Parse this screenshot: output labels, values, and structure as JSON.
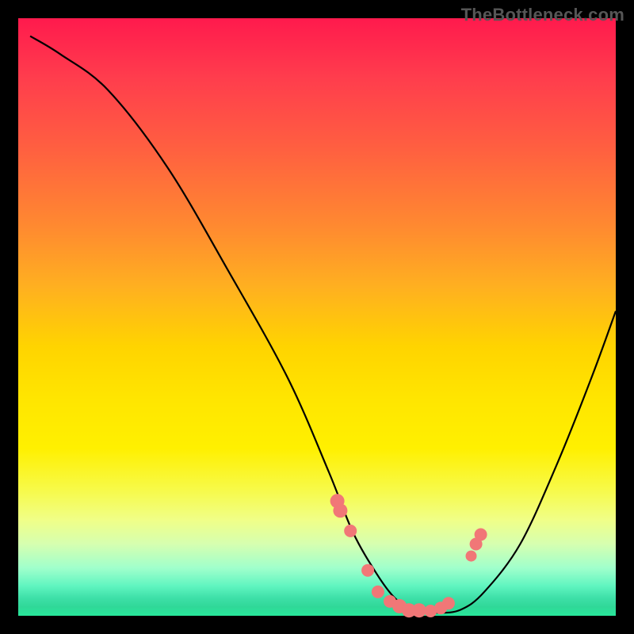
{
  "watermark": "TheBottleneck.com",
  "colors": {
    "background": "#000000",
    "gradient_top": "#ff1a4d",
    "gradient_bottom": "#28e69a",
    "curve": "#000000",
    "bead": "#f17777"
  },
  "chart_data": {
    "type": "line",
    "title": "",
    "xlabel": "",
    "ylabel": "",
    "xrange": [
      0,
      100
    ],
    "yrange": [
      0,
      100
    ],
    "series": [
      {
        "name": "bottleneck-curve",
        "x": [
          2,
          7,
          15,
          25,
          35,
          45,
          52,
          56,
          60,
          63,
          66,
          70,
          74,
          78,
          84,
          90,
          96,
          100
        ],
        "y": [
          97,
          94,
          88,
          75,
          58,
          40,
          24,
          14,
          7,
          3,
          1,
          0.5,
          1,
          4,
          12,
          25,
          40,
          51
        ]
      }
    ],
    "beads": {
      "name": "highlight-points",
      "x": [
        53.4,
        53.9,
        55.6,
        58.5,
        60.2,
        62.2,
        63.8,
        65.4,
        67.1,
        69.0,
        70.7,
        72.0,
        75.8,
        76.6,
        77.4
      ],
      "y": [
        19.2,
        17.6,
        14.2,
        7.6,
        4.0,
        2.4,
        1.6,
        0.9,
        0.9,
        0.8,
        1.3,
        2.1,
        10.0,
        12.0,
        13.6
      ],
      "r": [
        9,
        9,
        8,
        8,
        8,
        8,
        9,
        9,
        9,
        8,
        8,
        8,
        7,
        8,
        8
      ]
    }
  }
}
